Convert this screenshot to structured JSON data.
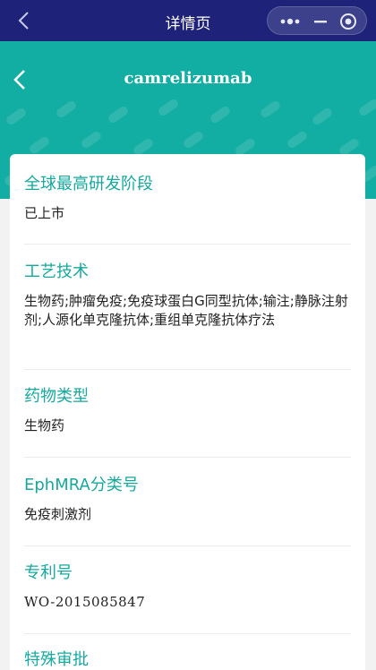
{
  "nav": {
    "page_title": "详情页"
  },
  "header": {
    "drug_name": "camrelizumab"
  },
  "fields": [
    {
      "label": "全球最高研发阶段",
      "value": "已上市"
    },
    {
      "label": "工艺技术",
      "value": "生物药;肿瘤免疫;免疫球蛋白G同型抗体;输注;静脉注射剂;人源化单克隆抗体;重组单克隆抗体疗法"
    },
    {
      "label": "药物类型",
      "value": "生物药"
    },
    {
      "label": "EphMRA分类号",
      "value": "免疫刺激剂"
    },
    {
      "label": "专利号",
      "value": "WO-2015085847"
    },
    {
      "label": "特殊审批",
      "value": ""
    }
  ],
  "icons": {
    "nav_back": "chevron-left-icon",
    "capsule_more": "more-dots-icon",
    "capsule_minimize": "minimize-icon",
    "capsule_close": "target-circle-icon",
    "header_back": "chevron-left-icon"
  },
  "colors": {
    "nav_bar": "#1e2278",
    "header": "#13aea3",
    "label": "#17a89e",
    "value_text": "#222222",
    "page_bg": "#f2f2f2"
  }
}
